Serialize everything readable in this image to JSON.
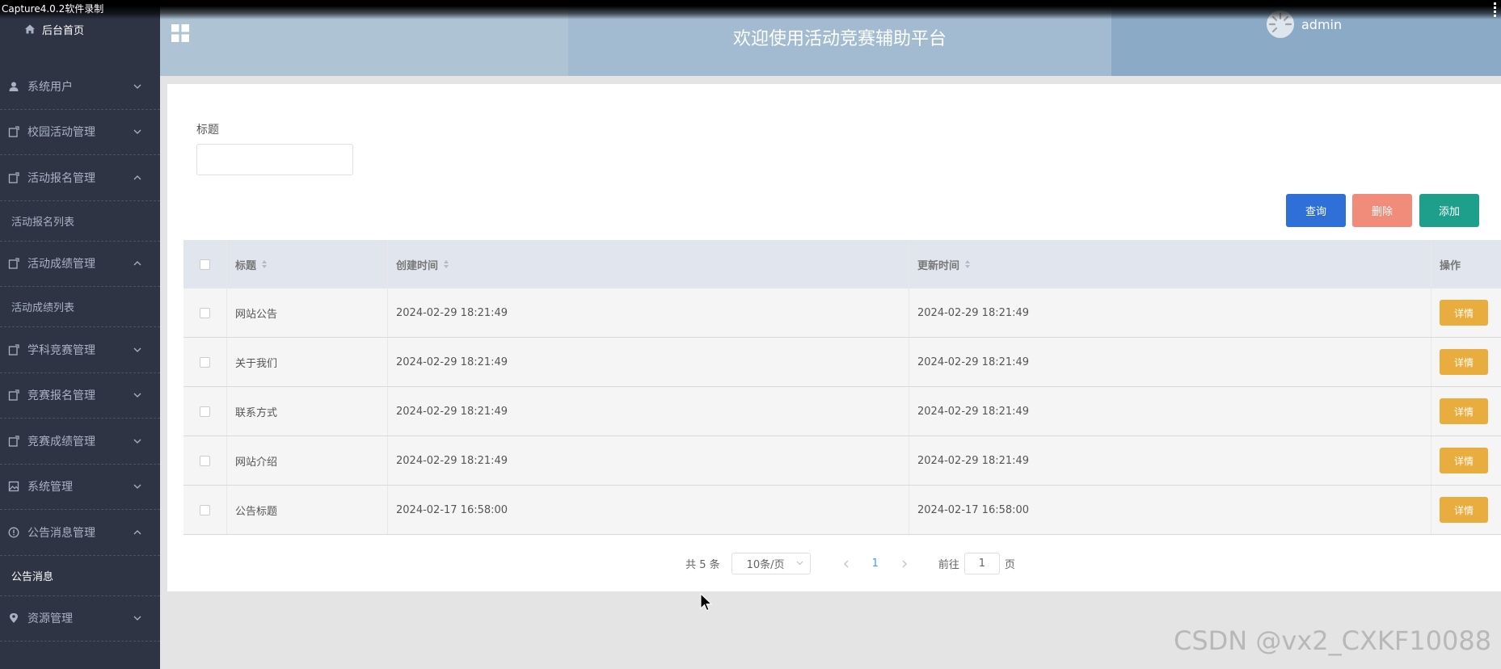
{
  "capture_title": "Capture4.0.2软件录制",
  "sidebar": {
    "home": "后台首页",
    "items": [
      {
        "label": "系统用户",
        "icon": "user-icon",
        "open": false
      },
      {
        "label": "校园活动管理",
        "icon": "doc-icon",
        "open": false
      },
      {
        "label": "活动报名管理",
        "icon": "doc-icon",
        "open": true,
        "sub": "活动报名列表"
      },
      {
        "label": "活动成绩管理",
        "icon": "doc-icon",
        "open": true,
        "sub": "活动成绩列表"
      },
      {
        "label": "学科竞赛管理",
        "icon": "doc-icon",
        "open": false
      },
      {
        "label": "竞赛报名管理",
        "icon": "doc-icon",
        "open": false
      },
      {
        "label": "竞赛成绩管理",
        "icon": "doc-icon",
        "open": false
      },
      {
        "label": "系统管理",
        "icon": "picture-icon",
        "open": false
      },
      {
        "label": "公告消息管理",
        "icon": "info-icon",
        "open": true,
        "sub": "公告消息"
      },
      {
        "label": "资源管理",
        "icon": "location-icon",
        "open": false
      }
    ]
  },
  "header": {
    "title": "欢迎使用活动竞赛辅助平台",
    "user": "admin"
  },
  "search": {
    "label": "标题",
    "value": ""
  },
  "buttons": {
    "query": "查询",
    "delete": "删除",
    "add": "添加"
  },
  "table": {
    "headers": {
      "title": "标题",
      "created": "创建时间",
      "updated": "更新时间",
      "op": "操作"
    },
    "rows": [
      {
        "title": "网站公告",
        "created": "2024-02-29 18:21:49",
        "updated": "2024-02-29 18:21:49",
        "action": "详情"
      },
      {
        "title": "关于我们",
        "created": "2024-02-29 18:21:49",
        "updated": "2024-02-29 18:21:49",
        "action": "详情"
      },
      {
        "title": "联系方式",
        "created": "2024-02-29 18:21:49",
        "updated": "2024-02-29 18:21:49",
        "action": "详情"
      },
      {
        "title": "网站介绍",
        "created": "2024-02-29 18:21:49",
        "updated": "2024-02-29 18:21:49",
        "action": "详情"
      },
      {
        "title": "公告标题",
        "created": "2024-02-17 16:58:00",
        "updated": "2024-02-17 16:58:00",
        "action": "详情"
      }
    ]
  },
  "pager": {
    "total": "共 5 条",
    "page_size": "10条/页",
    "current": "1",
    "goto_prefix": "前往",
    "goto_value": "1",
    "goto_suffix": "页"
  },
  "watermark": "CSDN @vx2_CXKF10088"
}
